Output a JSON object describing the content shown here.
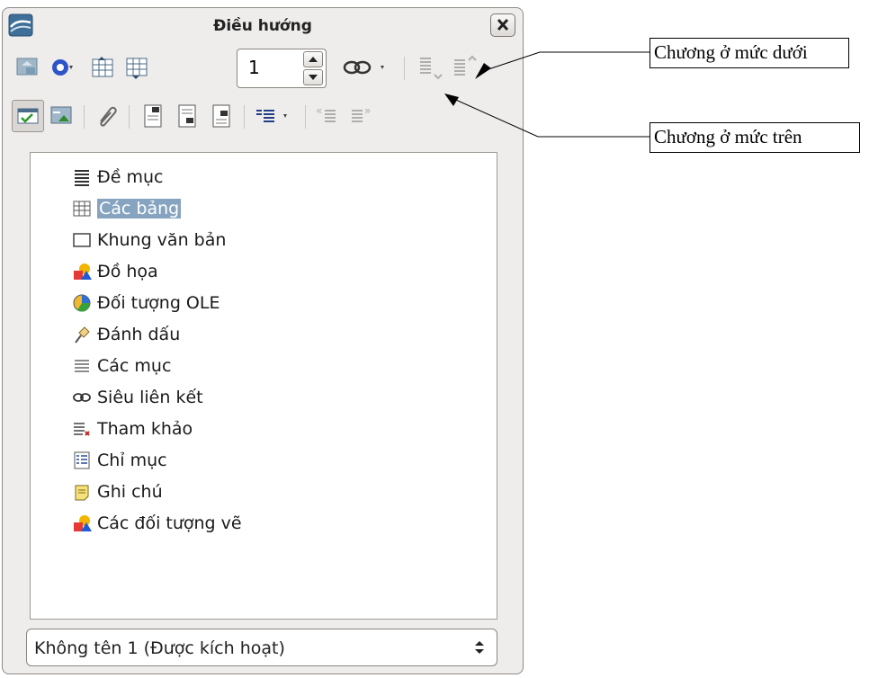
{
  "window": {
    "title": "Điều hướng"
  },
  "toolbar": {
    "level_value": "1"
  },
  "tree": {
    "items": [
      {
        "label": "Đề mục",
        "icon": "headings-icon"
      },
      {
        "label": "Các bảng",
        "icon": "table-icon",
        "selected": true
      },
      {
        "label": "Khung văn bản",
        "icon": "text-frame-icon"
      },
      {
        "label": "Đồ họa",
        "icon": "graphics-icon"
      },
      {
        "label": "Đối tượng OLE",
        "icon": "ole-object-icon"
      },
      {
        "label": "Đánh dấu",
        "icon": "bookmark-icon"
      },
      {
        "label": "Các mục",
        "icon": "sections-icon"
      },
      {
        "label": "Siêu liên kết",
        "icon": "hyperlink-icon"
      },
      {
        "label": "Tham khảo",
        "icon": "references-icon"
      },
      {
        "label": "Chỉ mục",
        "icon": "indexes-icon"
      },
      {
        "label": "Ghi chú",
        "icon": "comments-icon"
      },
      {
        "label": "Các đối tượng vẽ",
        "icon": "drawing-objects-icon"
      }
    ]
  },
  "document_select": {
    "value": "Không tên 1 (Được kích hoạt)"
  },
  "annotations": {
    "demote": "Chương ở mức dưới",
    "promote": "Chương ở mức trên"
  },
  "colors": {
    "selection": "#86a4c0",
    "window_bg": "#efedec"
  }
}
